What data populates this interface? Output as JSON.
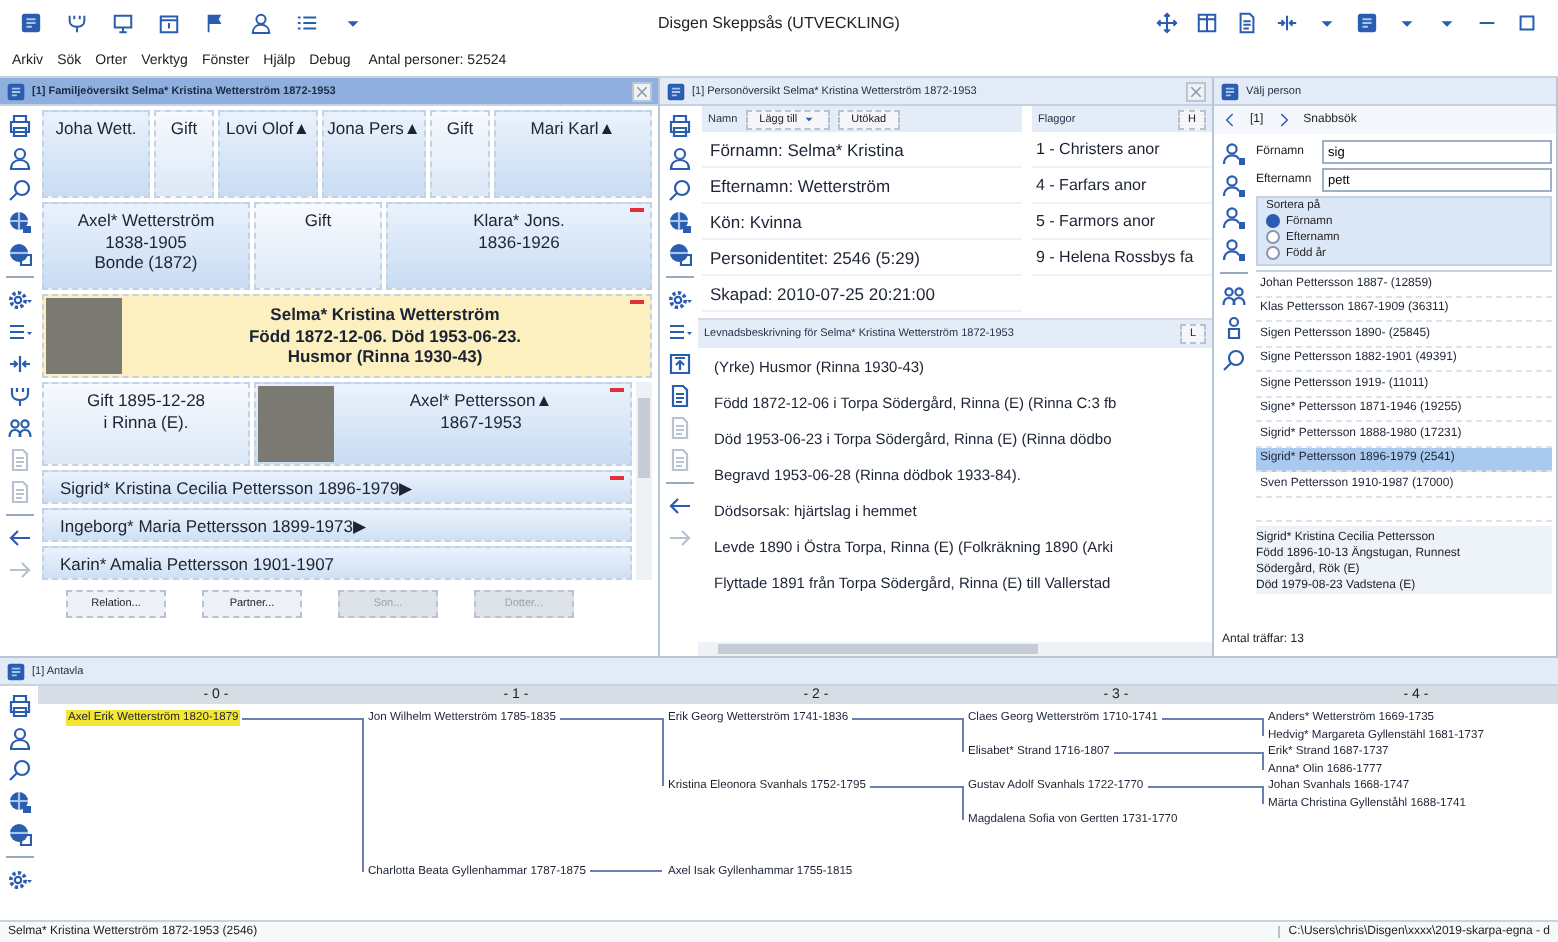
{
  "titlebar": {
    "title": "Disgen Skeppsås (UTVECKLING)",
    "left_icons": [
      {
        "kind": "app"
      },
      {
        "kind": "fork"
      },
      {
        "kind": "monitor"
      },
      {
        "kind": "calendar"
      },
      {
        "kind": "flag"
      },
      {
        "kind": "person"
      },
      {
        "kind": "list"
      },
      {
        "kind": "dropdown"
      }
    ],
    "right_icons": [
      {
        "kind": "move"
      },
      {
        "kind": "layout"
      },
      {
        "kind": "document"
      },
      {
        "kind": "split"
      },
      {
        "kind": "dropdown"
      },
      {
        "kind": "app"
      },
      {
        "kind": "dropdown"
      },
      {
        "kind": "dropdown"
      },
      {
        "kind": "minimize"
      },
      {
        "kind": "maximize"
      }
    ]
  },
  "menu": {
    "items": [
      "Arkiv",
      "Sök",
      "Orter",
      "Verktyg",
      "Fönster",
      "Hjälp",
      "Debug"
    ],
    "count_label": "Antal personer: 52524"
  },
  "family": {
    "title": "[1] Familjeöversikt Selma* Kristina Wetterström 1872-1953",
    "active": true,
    "closable": true,
    "toolbar": [
      {
        "kind": "printer",
        "disabled": false
      },
      {
        "kind": "person",
        "disabled": false
      },
      {
        "kind": "search",
        "disabled": false
      },
      {
        "kind": "globe",
        "disabled": false
      },
      {
        "kind": "globe-window",
        "disabled": false
      },
      {
        "kind": "separator"
      },
      {
        "kind": "gear",
        "disabled": false
      },
      {
        "kind": "menu",
        "disabled": false
      },
      {
        "kind": "split",
        "disabled": false
      },
      {
        "kind": "fork",
        "disabled": false
      },
      {
        "kind": "people",
        "disabled": false
      },
      {
        "kind": "document",
        "disabled": true
      },
      {
        "kind": "document",
        "disabled": true
      },
      {
        "kind": "separator"
      },
      {
        "kind": "arrow-left",
        "disabled": false
      },
      {
        "kind": "arrow-right",
        "disabled": true
      }
    ],
    "grandparents": [
      {
        "kind": "person",
        "text": "Joha Wett."
      },
      {
        "kind": "marriage",
        "text": "Gift"
      },
      {
        "kind": "person",
        "text": "Lovi Olof▲"
      },
      {
        "kind": "person",
        "text": "Jona Pers▲"
      },
      {
        "kind": "marriage",
        "text": "Gift"
      },
      {
        "kind": "person",
        "text": "Mari Karl▲"
      }
    ],
    "parents": [
      {
        "kind": "person",
        "lines": [
          "Axel* Wetterström",
          "1838-1905",
          "Bonde (1872)"
        ],
        "marked": false
      },
      {
        "kind": "marriage",
        "lines": [
          "Gift"
        ],
        "marked": false
      },
      {
        "kind": "person",
        "lines": [
          "Klara* Jons.",
          "1836-1926"
        ],
        "marked": true
      }
    ],
    "main": {
      "lines": [
        "Selma* Kristina Wetterström",
        "Född 1872-12-06. Död 1953-06-23.",
        "Husmor (Rinna 1930-43)"
      ],
      "marked": true
    },
    "marriage": {
      "lines": [
        "Gift 1895-12-28",
        "i Rinna (E)."
      ]
    },
    "spouse": {
      "lines": [
        "Axel* Pettersson▲",
        "1867-1953"
      ],
      "marked": true
    },
    "children": [
      {
        "text": "Sigrid* Kristina Cecilia Pettersson 1896-1979▶",
        "marked": true
      },
      {
        "text": "Ingeborg* Maria Pettersson 1899-1973▶",
        "marked": false
      },
      {
        "text": "Karin* Amalia Pettersson 1901-1907",
        "marked": false
      }
    ],
    "buttons": [
      {
        "label": "Relation...",
        "disabled": false
      },
      {
        "label": "Partner...",
        "disabled": false
      },
      {
        "label": "Son...",
        "disabled": true
      },
      {
        "label": "Dotter...",
        "disabled": true
      }
    ]
  },
  "person": {
    "title": "[1] Personöversikt Selma* Kristina Wetterström 1872-1953",
    "active": false,
    "closable": true,
    "toolbar": [
      {
        "kind": "printer",
        "disabled": false
      },
      {
        "kind": "person",
        "disabled": false
      },
      {
        "kind": "search",
        "disabled": false
      },
      {
        "kind": "globe",
        "disabled": false
      },
      {
        "kind": "globe-window",
        "disabled": false
      },
      {
        "kind": "separator"
      },
      {
        "kind": "gear",
        "disabled": false
      },
      {
        "kind": "menu",
        "disabled": false
      },
      {
        "kind": "upload-box",
        "disabled": false
      },
      {
        "kind": "document",
        "disabled": false
      },
      {
        "kind": "document",
        "disabled": true
      },
      {
        "kind": "document",
        "disabled": true
      },
      {
        "kind": "separator"
      },
      {
        "kind": "arrow-left",
        "disabled": false
      },
      {
        "kind": "arrow-right",
        "disabled": true
      }
    ],
    "names": {
      "header": "Namn",
      "add_button": "Lägg till",
      "extended_button": "Utökad",
      "rows": [
        "Förnamn: Selma* Kristina",
        "Efternamn: Wetterström",
        "Kön: Kvinna",
        "Personidentitet: 2546 (5:29)",
        "Skapad: 2010-07-25 20:21:00"
      ]
    },
    "flags": {
      "header": "Flaggor",
      "button": "H",
      "rows": [
        "1 - Christers anor",
        "4 - Farfars anor",
        "5 - Farmors anor",
        "9 - Helena Rossbys fa"
      ]
    },
    "biography": {
      "header": "Levnadsbeskrivning för Selma* Kristina Wetterström 1872-1953",
      "button": "L",
      "rows": [
        "(Yrke) Husmor (Rinna 1930-43)",
        "Född 1872-12-06 i Torpa Södergård, Rinna (E) (Rinna C:3 fb",
        "Död 1953-06-23 i Torpa Södergård, Rinna (E) (Rinna dödbo",
        "Begravd 1953-06-28 (Rinna dödbok 1933-84).",
        "Dödsorsak: hjärtslag i hemmet",
        "Levde 1890 i Östra Torpa, Rinna (E) (Folkräkning 1890 (Arki",
        "Flyttade 1891 från Torpa Södergård, Rinna (E) till Vallerstad"
      ]
    }
  },
  "chooser": {
    "title": "Välj person",
    "active": false,
    "closable": false,
    "nav_index": "[1]",
    "nav_label": "Snabbsök",
    "toolbar": [
      {
        "kind": "person-tag",
        "disabled": false
      },
      {
        "kind": "person-tag",
        "disabled": false
      },
      {
        "kind": "person-tag",
        "disabled": false
      },
      {
        "kind": "person-tag",
        "disabled": false
      },
      {
        "kind": "separator"
      },
      {
        "kind": "people",
        "disabled": false
      },
      {
        "kind": "person-small",
        "disabled": false
      },
      {
        "kind": "search",
        "disabled": false
      }
    ],
    "fields": [
      {
        "label": "Förnamn",
        "value": "sig"
      },
      {
        "label": "Efternamn",
        "value": "pett"
      }
    ],
    "sort": {
      "label": "Sortera på",
      "options": [
        {
          "label": "Förnamn",
          "selected": true
        },
        {
          "label": "Efternamn",
          "selected": false
        },
        {
          "label": "Född år",
          "selected": false
        }
      ]
    },
    "results": [
      {
        "text": "Johan Pettersson 1887- (12859)",
        "selected": false
      },
      {
        "text": "Klas Pettersson 1867-1909 (36311)",
        "selected": false
      },
      {
        "text": "Sigen Pettersson 1890- (25845)",
        "selected": false
      },
      {
        "text": "Signe Pettersson 1882-1901 (49391)",
        "selected": false
      },
      {
        "text": "Signe Pettersson 1919- (11011)",
        "selected": false
      },
      {
        "text": "Signe* Pettersson 1871-1946 (19255)",
        "selected": false
      },
      {
        "text": "Sigrid* Pettersson 1888-1980 (17231)",
        "selected": false
      },
      {
        "text": "Sigrid* Pettersson 1896-1979 (2541)",
        "selected": true
      },
      {
        "text": "Sven Pettersson 1910-1987 (17000)",
        "selected": false
      }
    ],
    "details": [
      "Sigrid* Kristina Cecilia Pettersson",
      "Född 1896-10-13 Ängstugan, Runnest",
      "Södergård, Rök (E)",
      "Död 1979-08-23 Vadstena (E)"
    ],
    "footer": "Antal träffar: 13"
  },
  "pedigree": {
    "title": "[1] Antavla",
    "active": false,
    "closable": false,
    "toolbar": [
      {
        "kind": "printer",
        "disabled": false
      },
      {
        "kind": "person",
        "disabled": false
      },
      {
        "kind": "search",
        "disabled": false
      },
      {
        "kind": "globe",
        "disabled": false
      },
      {
        "kind": "globe-window",
        "disabled": false
      },
      {
        "kind": "separator"
      },
      {
        "kind": "gear",
        "disabled": false
      }
    ],
    "generations": [
      "- 0 -",
      "- 1 -",
      "- 2 -",
      "- 3 -",
      "- 4 -"
    ],
    "tree": {
      "name": "Axel Erik Wetterström 1820-1879",
      "selected": true,
      "children": [
        {
          "name": "Jon Wilhelm Wetterström 1785-1835",
          "selected": false,
          "children": [
            {
              "name": "Erik Georg Wetterström 1741-1836",
              "selected": false,
              "children": [
                {
                  "name": "Claes Georg Wetterström 1710-1741",
                  "selected": false,
                  "children": [
                    {
                      "name": "Anders* Wetterström 1669-1735",
                      "selected": false
                    },
                    {
                      "name": "Hedvig* Margareta Gyllenstähl 1681-1737",
                      "selected": false
                    }
                  ]
                },
                {
                  "name": "Elisabet* Strand 1716-1807",
                  "selected": false,
                  "children": [
                    {
                      "name": "Erik* Strand 1687-1737",
                      "selected": false
                    },
                    {
                      "name": "Anna* Olin 1686-1777",
                      "selected": false
                    }
                  ]
                }
              ]
            },
            {
              "name": "Kristina Eleonora Svanhals 1752-1795",
              "selected": false,
              "children": [
                {
                  "name": "Gustav Adolf Svanhals 1722-1770",
                  "selected": false,
                  "children": [
                    {
                      "name": "Johan Svanhals 1668-1747",
                      "selected": false
                    },
                    {
                      "name": "Märta Christina Gyllenståhl 1688-1741",
                      "selected": false
                    }
                  ]
                },
                {
                  "name": "Magdalena Sofia von Gertten 1731-1770",
                  "selected": false
                }
              ]
            }
          ]
        },
        {
          "name": "Charlotta Beata Gyllenhammar 1787-1875",
          "selected": false,
          "children": [
            {
              "name": "Axel Isak Gyllenhammar 1755-1815",
              "selected": false
            }
          ]
        }
      ]
    }
  },
  "status_bar": {
    "left": "Selma* Kristina Wetterström 1872-1953 (2546)",
    "right": "C:\\Users\\chris\\Disgen\\xxxx\\2019-skarpa-egna - d"
  }
}
